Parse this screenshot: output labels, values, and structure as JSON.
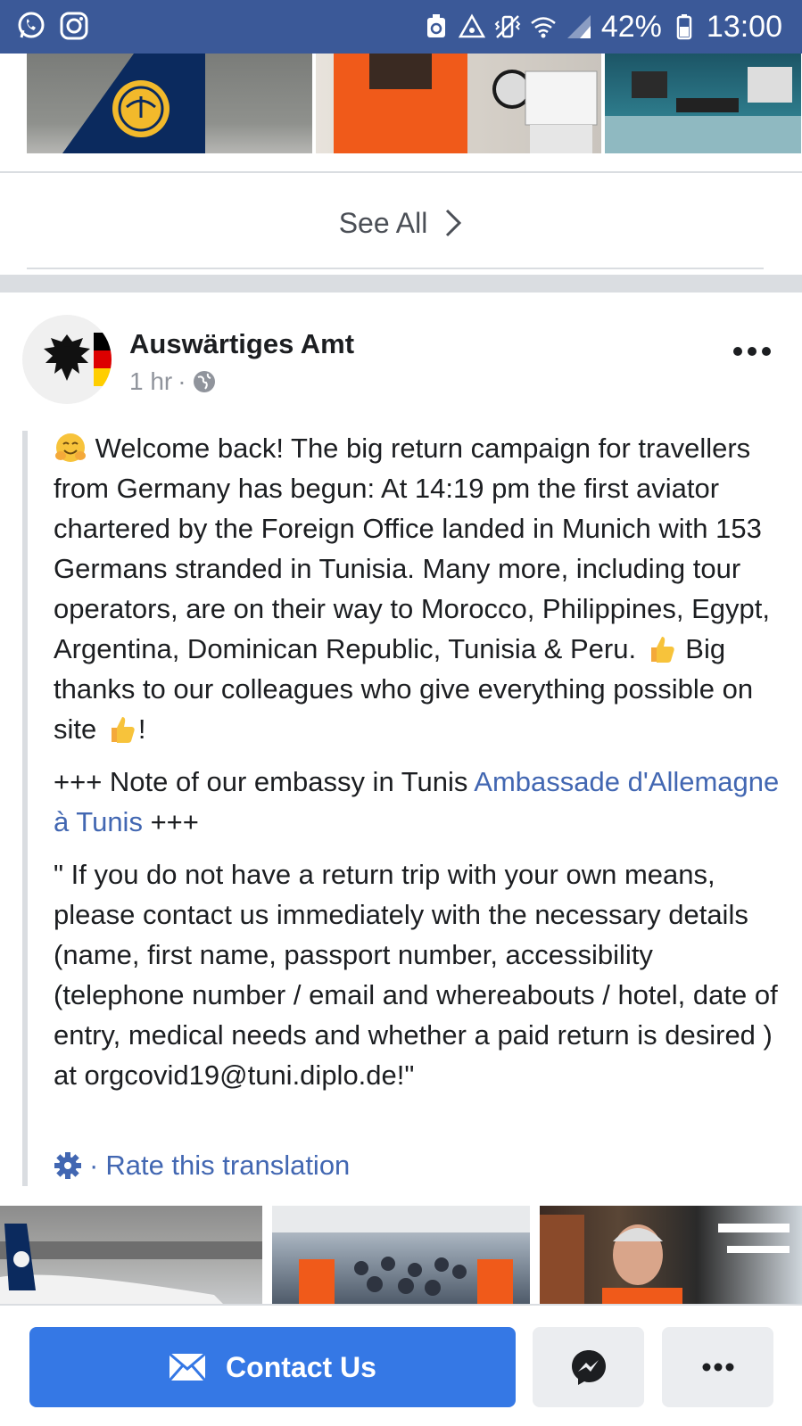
{
  "status_bar": {
    "battery_percent": "42%",
    "time": "13:00",
    "left_icons": [
      "whatsapp-icon",
      "instagram-icon"
    ],
    "right_icons": [
      "saver-icon",
      "tethering-icon",
      "vibrate-icon",
      "wifi-icon",
      "signal-icon",
      "battery-icon"
    ]
  },
  "photo_strip_top": {
    "see_all_label": "See All"
  },
  "post": {
    "author": "Auswärtiges Amt",
    "time": "1 hr",
    "separator": "·",
    "paragraph1": {
      "before_emoji1": " Welcome back! The big return campaign for travellers from Germany has begun: At 14:19 pm the first aviator chartered by the Foreign Office landed in Munich with 153 Germans stranded in Tunisia. Many more, including tour operators, are on their way to Morocco, Philippines, Egypt, Argentina, Dominican Republic, Tunisia & Peru. ",
      "between": " Big thanks to our colleagues who give everything possible on site ",
      "end": "!"
    },
    "paragraph2": {
      "prefix": "+++ Note of our embassy in Tunis ",
      "link": "Ambassade d'Allemagne à Tunis",
      "suffix": " +++"
    },
    "paragraph3": "\" If you do not have a return trip with your own means, please contact us immediately with the necessary details (name, first name, passport number, accessibility (telephone number / email and whereabouts / hotel, date of entry, medical needs and whether a paid return is desired ) at orgcovid19@tuni.diplo.de!\"",
    "rate_separator": "·",
    "rate_translation": "Rate this translation"
  },
  "action_bar": {
    "contact_label": "Contact Us"
  },
  "colors": {
    "facebook_blue": "#3b5998",
    "button_blue": "#3578e5",
    "link_blue": "#4267b2",
    "meta_gray": "#90949c"
  }
}
